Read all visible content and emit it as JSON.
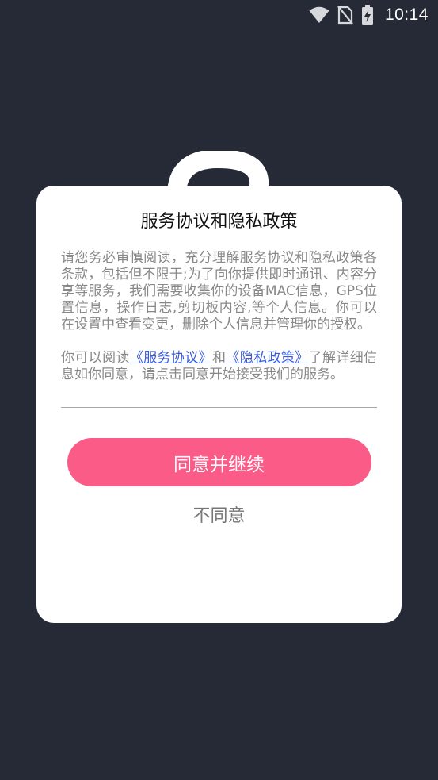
{
  "status_bar": {
    "time": "10:14",
    "icons": [
      "wifi-icon",
      "no-sim-icon",
      "battery-charging-icon"
    ]
  },
  "dialog": {
    "title": "服务协议和隐私政策",
    "paragraph1": "请您务必审慎阅读，充分理解服务协议和隐私政策各条款，包括但不限于;为了向你提供即时通讯、内容分享等服务，我们需要收集你的设备MAC信息，GPS位置信息，操作日志,剪切板内容,等个人信息。你可以在设置中查看变更，删除个人信息并管理你的授权。",
    "paragraph2_before": "你可以阅读",
    "service_link": "《服务协议》",
    "paragraph2_and": "和",
    "privacy_link": "《隐私政策》",
    "paragraph2_after": "了解详细信息如你同意，请点击同意开始接受我们的服务。",
    "agree_label": "同意并继续",
    "disagree_label": "不同意"
  },
  "colors": {
    "background": "#252a36",
    "accent": "#fb5b87",
    "link": "#3b5bd6"
  }
}
